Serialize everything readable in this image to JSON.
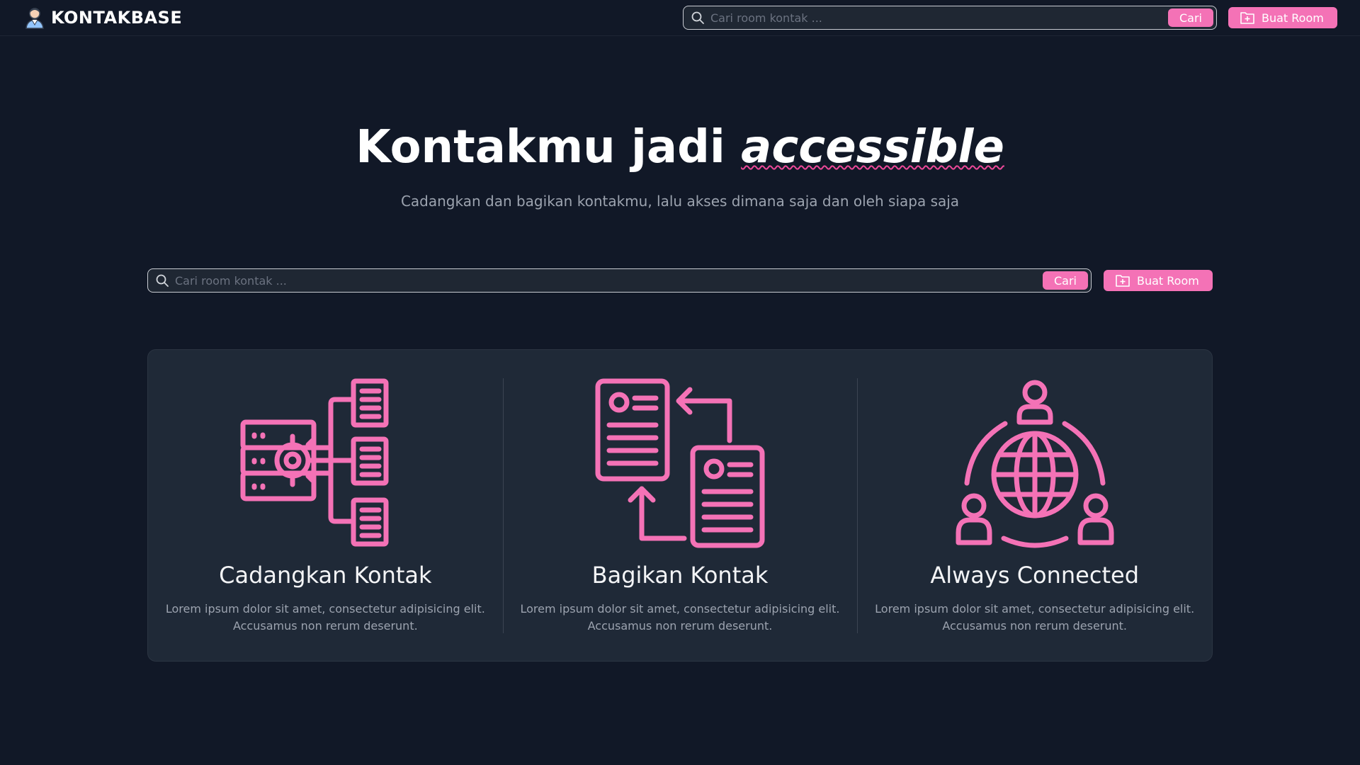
{
  "navbar": {
    "brand_name": "KONTAKBASE",
    "search_placeholder": "Cari room kontak ...",
    "search_button": "Cari",
    "create_button": "Buat Room"
  },
  "hero": {
    "title_plain": "Kontakmu jadi ",
    "title_em": "accessible",
    "subtitle": "Cadangkan dan bagikan kontakmu, lalu akses dimana saja dan oleh siapa saja",
    "search_placeholder": "Cari room kontak ...",
    "search_button": "Cari",
    "create_button": "Buat Room"
  },
  "features": [
    {
      "icon": "server-distribute-icon",
      "title": "Cadangkan Kontak",
      "description": "Lorem ipsum dolor sit amet, consectetur adipisicing elit. Accusamus non rerum deserunt."
    },
    {
      "icon": "exchange-documents-icon",
      "title": "Bagikan Kontak",
      "description": "Lorem ipsum dolor sit amet, consectetur adipisicing elit. Accusamus non rerum deserunt."
    },
    {
      "icon": "global-network-icon",
      "title": "Always Connected",
      "description": "Lorem ipsum dolor sit amet, consectetur adipisicing elit. Accusamus non rerum deserunt."
    }
  ],
  "colors": {
    "background": "#111827",
    "card": "#1f2937",
    "accent": "#f472b6",
    "muted_text": "#9ca3af"
  }
}
